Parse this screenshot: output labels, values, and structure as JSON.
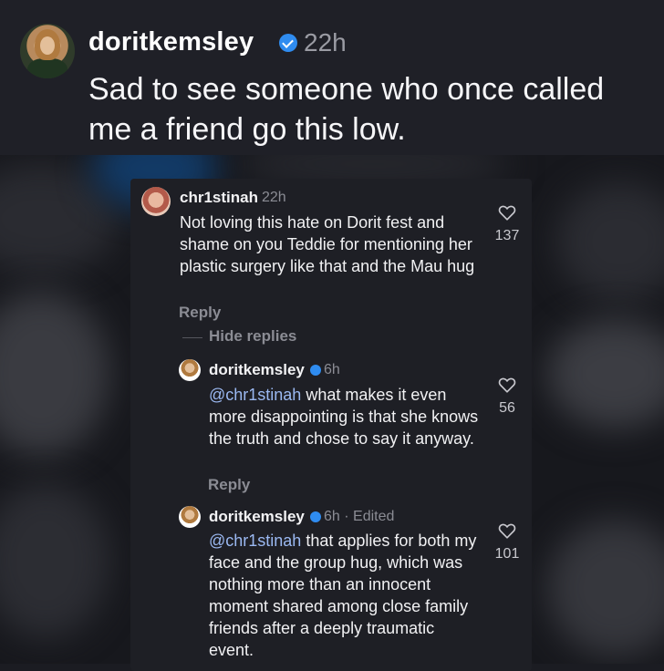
{
  "post": {
    "username": "doritkemsley",
    "time": "22h",
    "text": "Sad to see someone who once called me a friend go this low."
  },
  "comments": [
    {
      "username": "chr1stinah",
      "time": "22h",
      "text": "Not loving this hate on Dorit fest and shame on you Teddie for mentioning her plastic surgery like that and the Mau hug",
      "likes": "137",
      "reply_label": "Reply",
      "hide_replies_label": "Hide replies"
    }
  ],
  "replies": [
    {
      "username": "doritkemsley",
      "time": "6h",
      "mention": "@chr1stinah",
      "text": " what makes it even more disappointing is that she knows the truth and chose to say it anyway.",
      "likes": "56",
      "reply_label": "Reply"
    },
    {
      "username": "doritkemsley",
      "time": "6h · Edited",
      "mention": "@chr1stinah",
      "text": " that applies for both my face and the group hug, which was nothing more than an innocent moment shared among close family friends after a deeply traumatic event.",
      "likes": "101"
    }
  ],
  "colors": {
    "verified": "#2f8cf0",
    "mention": "#9bb9f2",
    "muted": "#8b8c94"
  },
  "icons": [
    "verified-badge-icon",
    "heart-icon"
  ]
}
